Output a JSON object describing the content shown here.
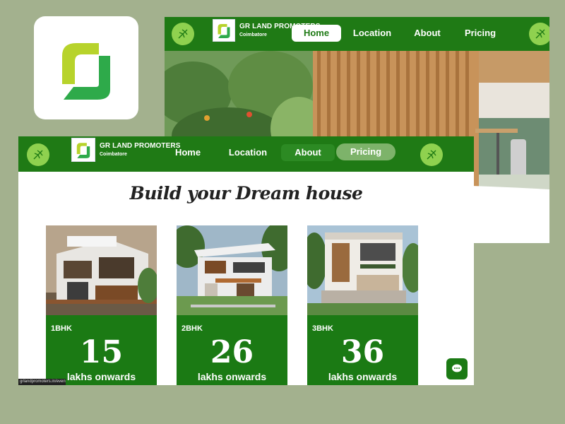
{
  "brand": {
    "name": "GR LAND PROMOTERS",
    "city": "Coimbatore",
    "logo_icon": "gr-logo-icon",
    "colors": {
      "primary": "#1f7a15",
      "accent": "#8fd14f",
      "logo_lime": "#b7d32b",
      "logo_green": "#2eaa4a"
    }
  },
  "back_window": {
    "nav": {
      "links": [
        {
          "label": "Home",
          "active": true
        },
        {
          "label": "Location",
          "active": false
        },
        {
          "label": "About",
          "active": false
        },
        {
          "label": "Pricing",
          "active": false
        }
      ]
    }
  },
  "front_window": {
    "nav": {
      "links": [
        {
          "label": "Home",
          "active": false
        },
        {
          "label": "Location",
          "active": false
        },
        {
          "label": "About",
          "active": false
        },
        {
          "label": "Pricing",
          "active": true
        }
      ]
    },
    "headline": "Build your Dream house",
    "cards": [
      {
        "type": "1BHK",
        "price": "15",
        "unit": "lakhs onwards"
      },
      {
        "type": "2BHK",
        "price": "26",
        "unit": "lakhs onwards"
      },
      {
        "type": "3BHK",
        "price": "36",
        "unit": "lakhs onwards"
      }
    ],
    "status_url": "grlandpromoters.in/events",
    "chat_icon": "chat-bubble-icon"
  }
}
